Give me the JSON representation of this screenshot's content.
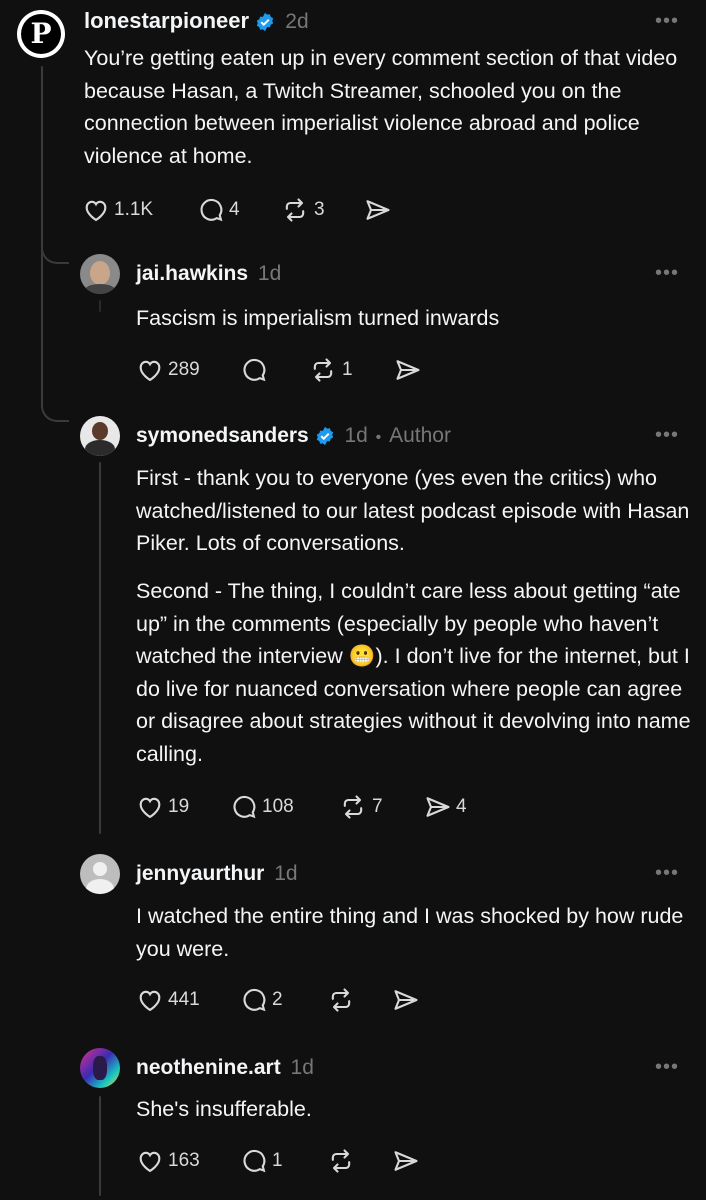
{
  "posts": [
    {
      "username": "lonestarpioneer",
      "verified": true,
      "time": "2d",
      "avatar_letter": "P",
      "body": "You’re getting eaten up in every comment section of that video because Hasan, a Twitch Streamer, schooled you on the connection between imperialist violence abroad and police violence at home.",
      "likes": "1.1K",
      "comments": "4",
      "reposts": "3",
      "shares": ""
    },
    {
      "username": "jai.hawkins",
      "time": "1d",
      "body": "Fascism is imperialism turned inwards",
      "likes": "289",
      "comments": "",
      "reposts": "1",
      "shares": ""
    },
    {
      "username": "symonedsanders",
      "verified": true,
      "time": "1d",
      "author_tag": "Author",
      "body_p1": "First - thank you to everyone (yes even the critics) who watched/listened to our latest podcast episode with Hasan Piker. Lots of conversations.",
      "body_p2_a": "Second - The thing, I couldn’t care less about getting “ate up” in the comments (especially by people who haven’t watched the interview ",
      "emoji": "😬",
      "body_p2_b": "). I don’t live for the internet, but I do live for nuanced conversation where people can agree or disagree about strategies without it devolving into name calling.",
      "likes": "19",
      "comments": "108",
      "reposts": "7",
      "shares": "4"
    },
    {
      "username": "jennyaurthur",
      "time": "1d",
      "body": "I watched the entire thing and I was shocked by how rude you were.",
      "likes": "441",
      "comments": "2",
      "reposts": "",
      "shares": ""
    },
    {
      "username": "neothenine.art",
      "time": "1d",
      "body": "She's insufferable.",
      "likes": "163",
      "comments": "1",
      "reposts": "",
      "shares": ""
    }
  ],
  "more_glyph": "•••",
  "dot_separator": "•",
  "icons": [
    "heart-icon",
    "comment-icon",
    "repost-icon",
    "share-icon",
    "more-icon",
    "verified-icon"
  ],
  "colors": {
    "background": "#101010",
    "text": "#f3f5f7",
    "muted": "#777777",
    "verified": "#1d9bf0",
    "thread_line": "#3a3a3a"
  }
}
